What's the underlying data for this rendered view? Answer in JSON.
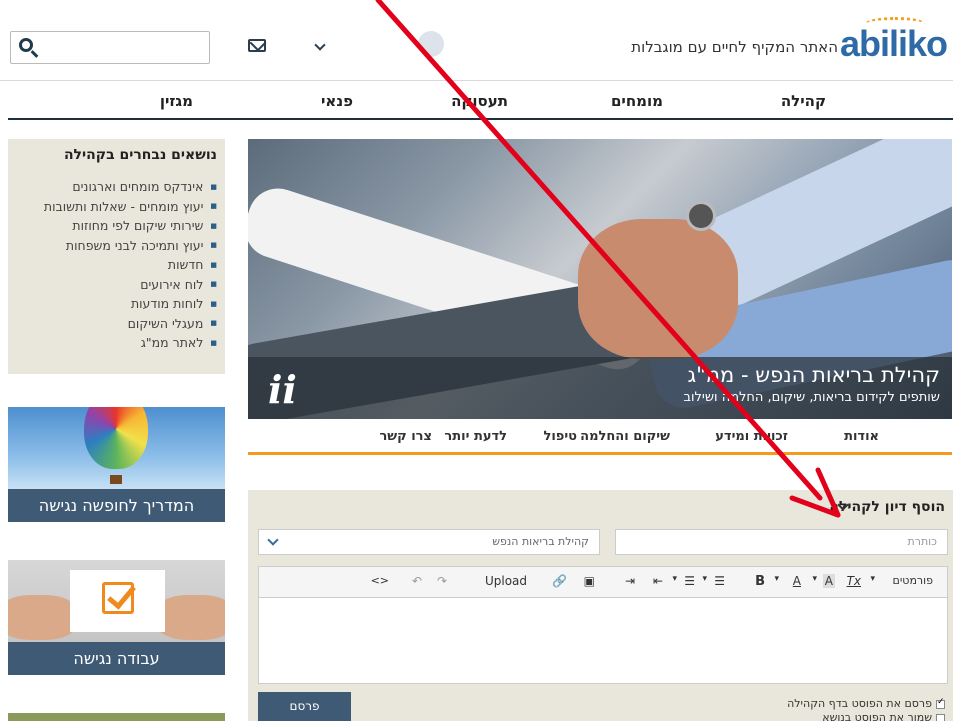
{
  "header": {
    "logo_text": "abiliko",
    "tagline": "האתר המקיף לחיים עם מוגבלות"
  },
  "nav": {
    "items": [
      "קהילה",
      "מומחים",
      "תעסוקה",
      "פנאי",
      "מגזין"
    ]
  },
  "sidebar": {
    "topics_title": "נושאים נבחרים בקהילה",
    "topics": [
      "אינדקס מומחים וארגונים",
      "יעוץ מומחים - שאלות ותשובות",
      "שירותי שיקום לפי מחוזות",
      "יעוץ ותמיכה לבני משפחות",
      "חדשות",
      "לוח אירועים",
      "לוחות מודעות",
      "מעגלי השיקום",
      "לאתר ממ\"ג"
    ],
    "cards": [
      {
        "caption": "המדריך לחופשה נגישה"
      },
      {
        "caption": "עבודה נגישה"
      }
    ]
  },
  "banner": {
    "title": "קהילת בריאות הנפש - ממ\"ג",
    "subtitle": "שותפים לקידום בריאות, שיקום, החלמה ושילוב",
    "logo_text": "ii"
  },
  "community_tabs": [
    "אודות",
    "זכויות ומידע",
    "שיקום והחלמה",
    "טיפול",
    "לדעת יותר",
    "צרו קשר"
  ],
  "form": {
    "title": "הוסף דיון לקהילה",
    "title_placeholder": "כותרת",
    "community_select": "קהילת בריאות הנפש",
    "toolbar": {
      "formats": "פורמטים",
      "bold": "B",
      "font_color": "A",
      "bg_color": "A",
      "clear_format": "Tx",
      "bullet_list": "☰",
      "numbered_list": "☰",
      "indent_more": "⇥",
      "indent_less": "⇤",
      "image": "▣",
      "link": "🔗",
      "upload": "Upload",
      "redo": "↷",
      "undo": "↶",
      "source": "<>"
    },
    "publish_label": "פרסם",
    "checkbox_publish_community": "פרסם את הפוסט בדף הקהילה",
    "checkbox_save_topic": "שמור את הפוסט בנושא"
  },
  "colors": {
    "accent": "#f39a1f",
    "nav_line": "#1f3040",
    "button": "#3f5a75",
    "sidebar_bg": "#e9e7db",
    "annotation": "#e2001a"
  }
}
